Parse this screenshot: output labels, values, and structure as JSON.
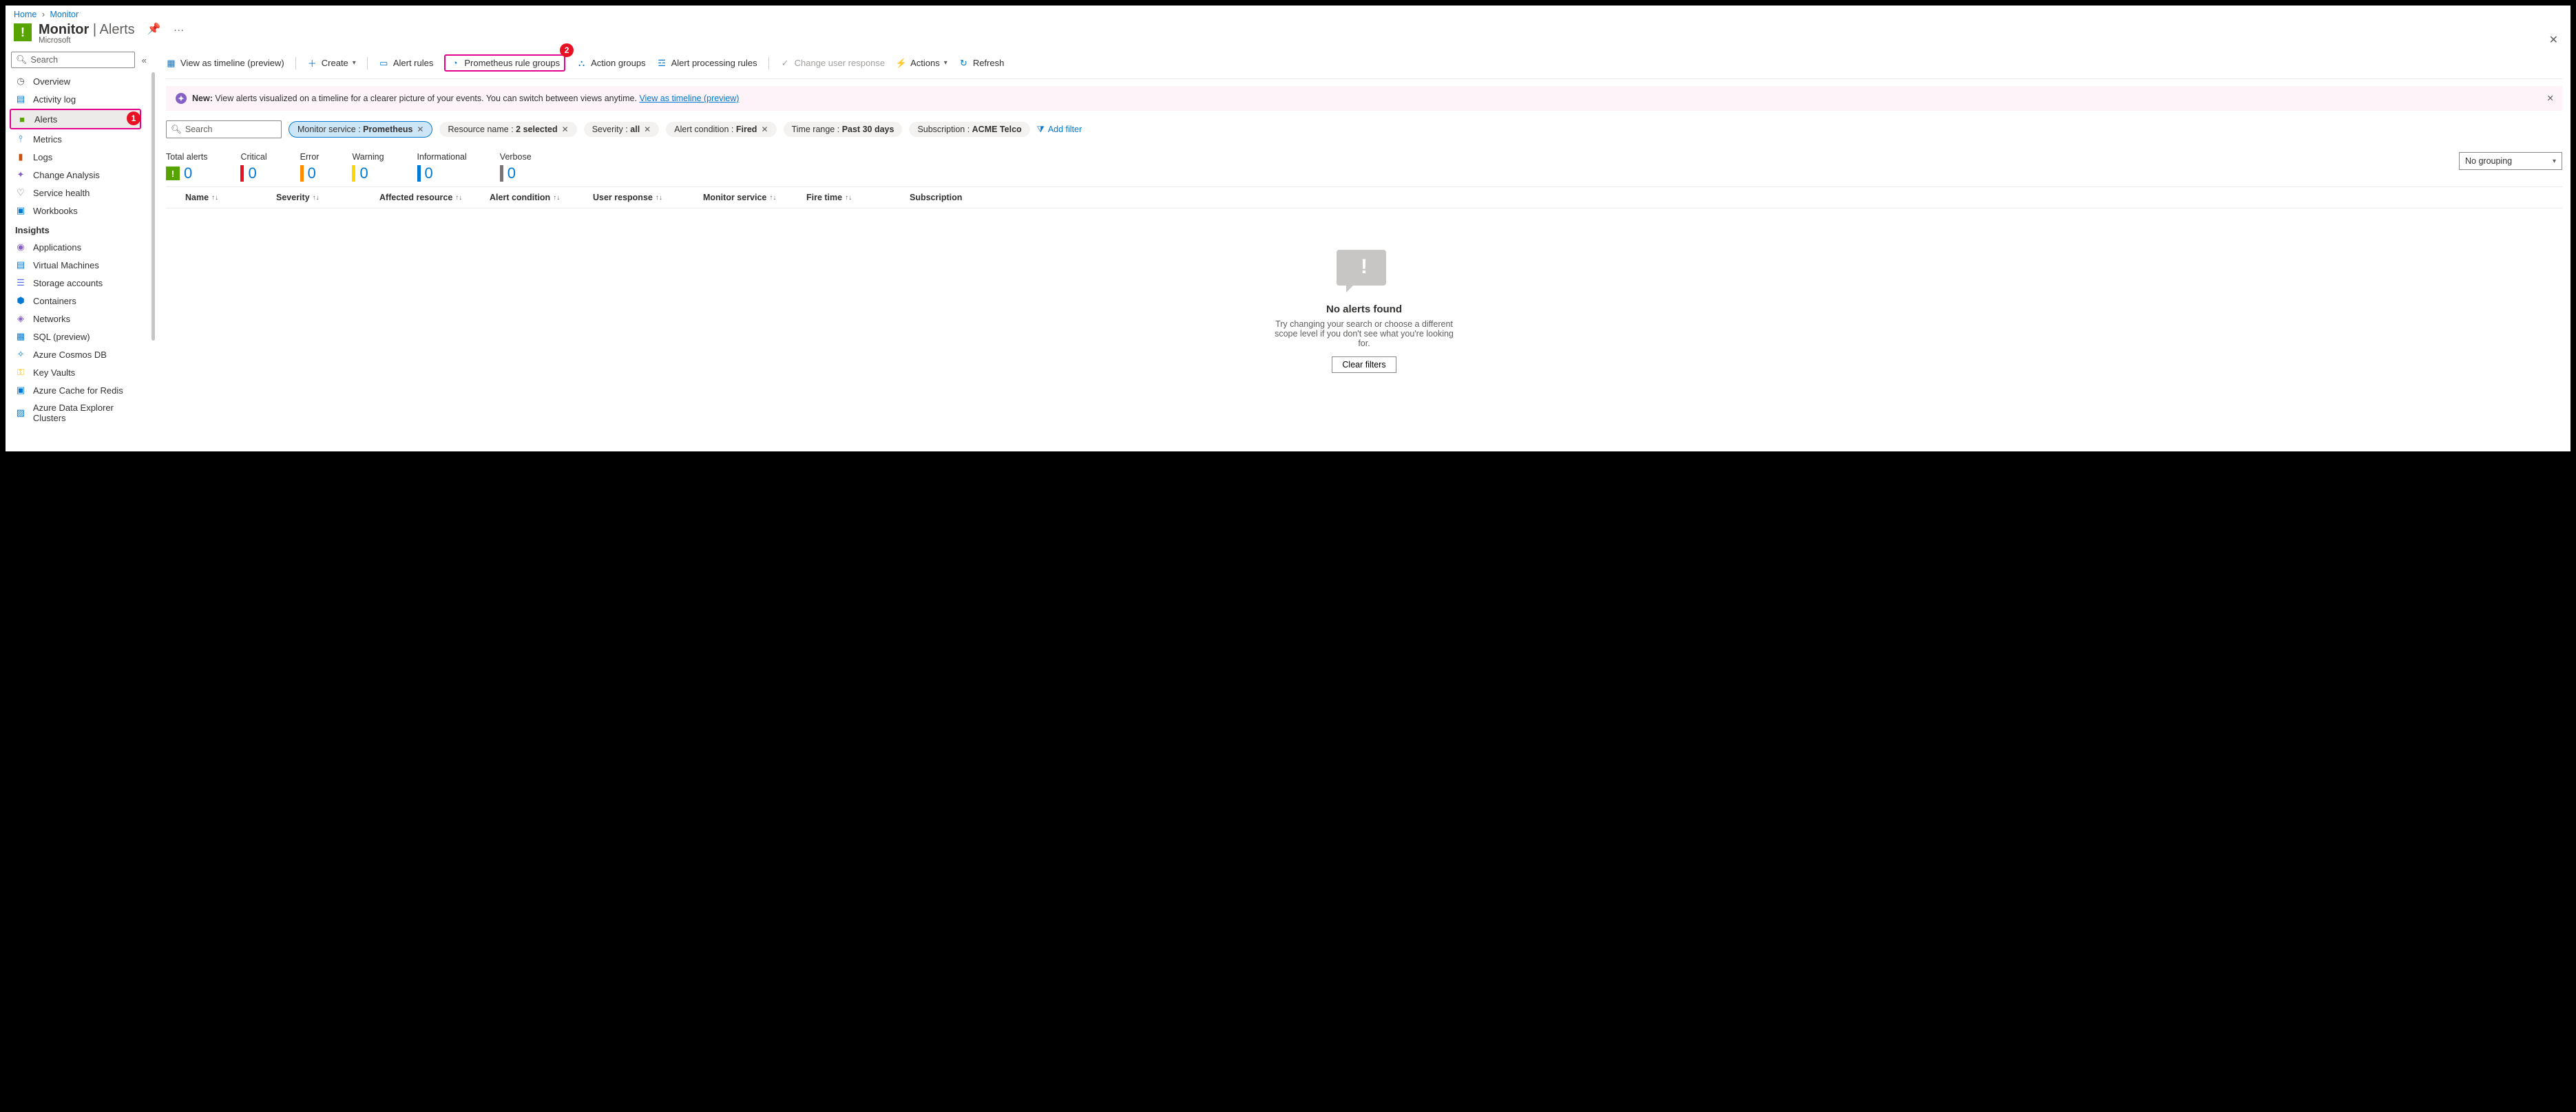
{
  "breadcrumb": {
    "home": "Home",
    "monitor": "Monitor"
  },
  "page": {
    "title_main": "Monitor",
    "title_sub": "Alerts",
    "publisher": "Microsoft"
  },
  "sidebar": {
    "search_placeholder": "Search",
    "items": [
      {
        "icon": "◷",
        "color": "#605e5c",
        "label": "Overview"
      },
      {
        "icon": "▤",
        "color": "#0078d4",
        "label": "Activity log"
      },
      {
        "icon": "■",
        "color": "#57a300",
        "label": "Alerts",
        "active": true
      },
      {
        "icon": "⫯",
        "color": "#0078d4",
        "label": "Metrics"
      },
      {
        "icon": "▮",
        "color": "#ca5010",
        "label": "Logs"
      },
      {
        "icon": "✦",
        "color": "#8661c5",
        "label": "Change Analysis"
      },
      {
        "icon": "♡",
        "color": "#605e5c",
        "label": "Service health"
      },
      {
        "icon": "▣",
        "color": "#0078d4",
        "label": "Workbooks"
      }
    ],
    "insights_title": "Insights",
    "insights": [
      {
        "icon": "◉",
        "color": "#8661c5",
        "label": "Applications"
      },
      {
        "icon": "▤",
        "color": "#0078d4",
        "label": "Virtual Machines"
      },
      {
        "icon": "☰",
        "color": "#4f6bed",
        "label": "Storage accounts"
      },
      {
        "icon": "⬢",
        "color": "#0078d4",
        "label": "Containers"
      },
      {
        "icon": "◈",
        "color": "#8661c5",
        "label": "Networks"
      },
      {
        "icon": "▦",
        "color": "#0078d4",
        "label": "SQL (preview)"
      },
      {
        "icon": "✧",
        "color": "#0078d4",
        "label": "Azure Cosmos DB"
      },
      {
        "icon": "⚿",
        "color": "#ffb900",
        "label": "Key Vaults"
      },
      {
        "icon": "▣",
        "color": "#0078d4",
        "label": "Azure Cache for Redis"
      },
      {
        "icon": "▨",
        "color": "#0078d4",
        "label": "Azure Data Explorer Clusters"
      }
    ]
  },
  "callouts": {
    "sidebar": "1",
    "toolbar": "2"
  },
  "toolbar": {
    "timeline": "View as timeline (preview)",
    "create": "Create",
    "alert_rules": "Alert rules",
    "prom_groups": "Prometheus rule groups",
    "action_groups": "Action groups",
    "processing": "Alert processing rules",
    "change_user": "Change user response",
    "actions": "Actions",
    "refresh": "Refresh"
  },
  "banner": {
    "prefix": "New:",
    "text": "View alerts visualized on a timeline for a clearer picture of your events. You can switch between views anytime.",
    "link": "View as timeline (preview)"
  },
  "filters": {
    "search_placeholder": "Search",
    "pills": [
      {
        "key": "Subscription",
        "value": "ACME Telco",
        "close": false
      },
      {
        "key": "Time range",
        "value": "Past 30 days",
        "close": false
      },
      {
        "key": "Alert condition",
        "value": "Fired",
        "close": true
      },
      {
        "key": "Severity",
        "value": "all",
        "close": true
      },
      {
        "key": "Resource name",
        "value": "2 selected",
        "close": true
      },
      {
        "key": "Monitor service",
        "value": "Prometheus",
        "close": true,
        "selected": true
      }
    ],
    "add_filter": "Add filter"
  },
  "stats": [
    {
      "label": "Total alerts",
      "value": "0",
      "cls": "total",
      "totalIcon": true
    },
    {
      "label": "Critical",
      "value": "0",
      "cls": "crit"
    },
    {
      "label": "Error",
      "value": "0",
      "cls": "err"
    },
    {
      "label": "Warning",
      "value": "0",
      "cls": "warn"
    },
    {
      "label": "Informational",
      "value": "0",
      "cls": "info"
    },
    {
      "label": "Verbose",
      "value": "0",
      "cls": "verb"
    }
  ],
  "grouping": {
    "selected": "No grouping"
  },
  "columns": {
    "name": "Name",
    "severity": "Severity",
    "resource": "Affected resource",
    "condition": "Alert condition",
    "user": "User response",
    "monitor": "Monitor service",
    "fire": "Fire time",
    "sub": "Subscription"
  },
  "empty": {
    "title": "No alerts found",
    "text": "Try changing your search or choose a different scope level if you don't see what you're looking for.",
    "button": "Clear filters"
  }
}
